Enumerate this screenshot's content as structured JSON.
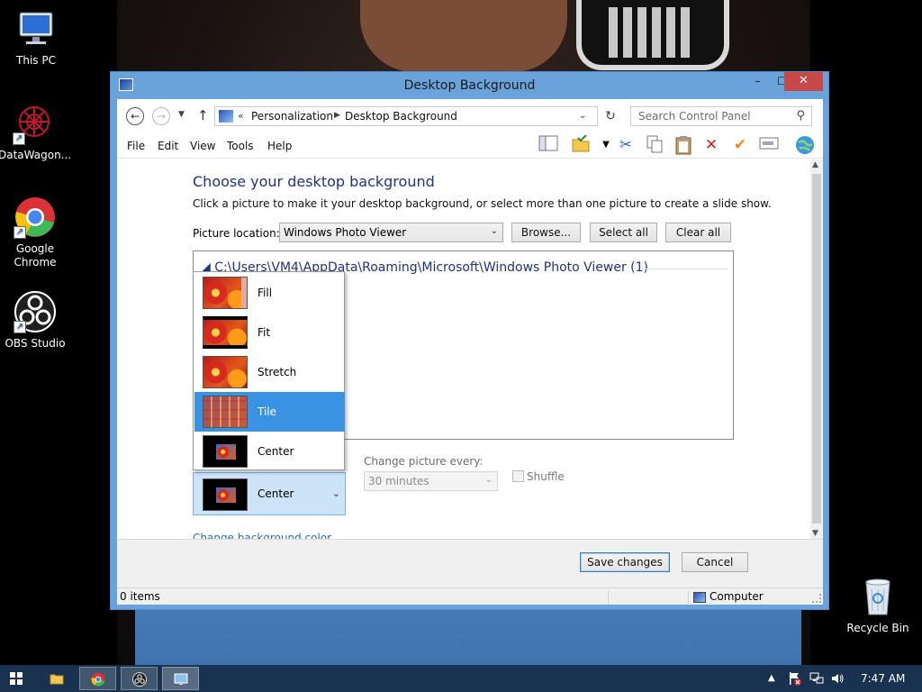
{
  "desktop": {
    "icons": [
      {
        "label": "This PC",
        "icon": "this-pc-icon"
      },
      {
        "label": "DataWagon...",
        "icon": "datawagon-icon"
      },
      {
        "label": "Google Chrome",
        "icon": "chrome-icon"
      },
      {
        "label": "OBS Studio",
        "icon": "obs-icon"
      },
      {
        "label": "Recycle Bin",
        "icon": "recycle-bin-icon"
      }
    ]
  },
  "window": {
    "title": "Desktop Background",
    "controls": {
      "minimize": "–",
      "maximize": "☐",
      "close": "✕"
    }
  },
  "address": {
    "separator": "«",
    "crumbs": [
      "Personalization",
      "Desktop Background"
    ],
    "search_placeholder": "Search Control Panel"
  },
  "menu": {
    "items": [
      "File",
      "Edit",
      "View",
      "Tools",
      "Help"
    ]
  },
  "main": {
    "heading": "Choose your desktop background",
    "description": "Click a picture to make it your desktop background, or select more than one picture to create a slide show.",
    "picture_location_label": "Picture location:",
    "picture_location_value": "Windows Photo Viewer",
    "browse_label": "Browse...",
    "select_all_label": "Select all",
    "clear_all_label": "Clear all",
    "group_header": "C:\\Users\\VM4\\AppData\\Roaming\\Microsoft\\Windows Photo Viewer (1)",
    "position_combo_value": "Center",
    "change_every_label": "Change picture every:",
    "change_every_value": "30 minutes",
    "shuffle_label": "Shuffle",
    "change_bg_color_link": "Change background color"
  },
  "position_dropdown": {
    "options": [
      "Fill",
      "Fit",
      "Stretch",
      "Tile",
      "Center"
    ],
    "highlighted": "Tile"
  },
  "footer": {
    "save_label": "Save changes",
    "cancel_label": "Cancel"
  },
  "status": {
    "items": "0 items",
    "computer": "Computer"
  },
  "taskbar": {
    "apps": [
      "file-explorer-icon",
      "chrome-icon",
      "obs-icon",
      "control-panel-icon"
    ],
    "time": "7:47 AM"
  },
  "colors": {
    "window_frame": "#6aa3da",
    "close_button": "#c74848",
    "heading": "#1e3287",
    "selection": "#3a92e2",
    "taskbar": "#18324f"
  }
}
